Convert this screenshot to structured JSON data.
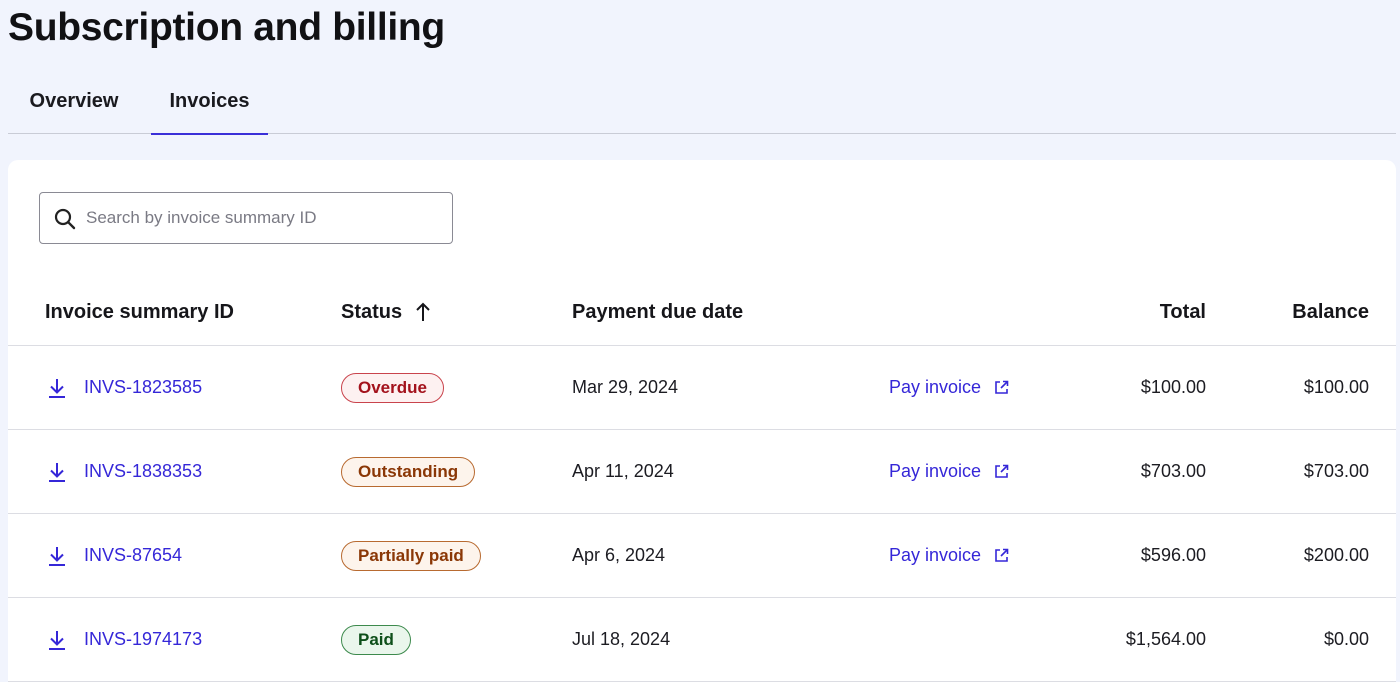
{
  "page": {
    "title": "Subscription and billing"
  },
  "tabs": [
    {
      "label": "Overview",
      "active": false
    },
    {
      "label": "Invoices",
      "active": true
    }
  ],
  "search": {
    "placeholder": "Search by invoice summary ID",
    "value": "",
    "icon": "search-icon"
  },
  "table": {
    "columns": {
      "id": "Invoice summary ID",
      "status": "Status",
      "due": "Payment due date",
      "total": "Total",
      "balance": "Balance"
    },
    "sort": {
      "column": "status",
      "direction": "ascending",
      "icon": "arrow-up-icon"
    },
    "rows": [
      {
        "id": "INVS-1823585",
        "status": "Overdue",
        "due": "Mar 29, 2024",
        "pay": "Pay invoice",
        "total": "$100.00",
        "balance": "$100.00"
      },
      {
        "id": "INVS-1838353",
        "status": "Outstanding",
        "due": "Apr 11, 2024",
        "pay": "Pay invoice",
        "total": "$703.00",
        "balance": "$703.00"
      },
      {
        "id": "INVS-87654",
        "status": "Partially paid",
        "due": "Apr 6, 2024",
        "pay": "Pay invoice",
        "total": "$596.00",
        "balance": "$200.00"
      },
      {
        "id": "INVS-1974173",
        "status": "Paid",
        "due": "Jul 18, 2024",
        "pay": "",
        "total": "$1,564.00",
        "balance": "$0.00"
      }
    ]
  },
  "colors": {
    "accent": "#3a2fd8",
    "link": "#3527d8",
    "background": "#f1f4fd",
    "overdue": "#a3121c",
    "outstanding": "#8a3706",
    "paid": "#0e4f1a"
  }
}
